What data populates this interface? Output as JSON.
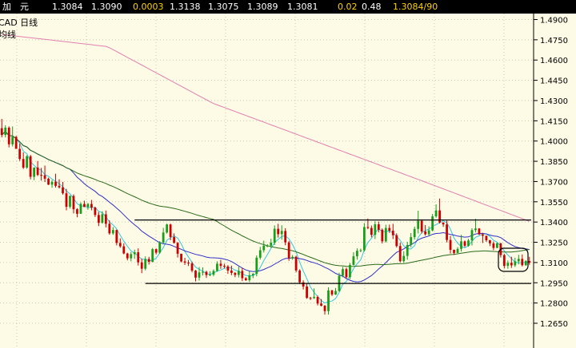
{
  "quote_bar": {
    "name": "加　元",
    "open": "1.3084",
    "high": "1.3090",
    "change": "0.0003",
    "last": "1.3138",
    "low": "1.3075",
    "bid": "1.3089",
    "ask": "1.3081",
    "pct": "0.02",
    "volume": "0.48",
    "bidask": "1.3084/90",
    "colors": {
      "label": "#ffffff",
      "highlight": "#ffd200"
    }
  },
  "chart_header": {
    "symbol_line": "CAD  日线",
    "ma_line": "均线"
  },
  "colors": {
    "background": "#fdfbe6",
    "grid": "#c8c8b4",
    "up_candle": "#1a9e1a",
    "down_candle": "#cc0000",
    "ma_fast": "#30c8e0",
    "ma_mid": "#3030c8",
    "ma_slow": "#2a6a1a",
    "ma_long": "#e080b0",
    "channel": "#000000"
  },
  "chart_data": {
    "type": "candlestick",
    "y_ticks": [
      "1.4900",
      "1.4750",
      "1.4600",
      "1.4450",
      "1.4300",
      "1.4150",
      "1.4000",
      "1.3850",
      "1.3700",
      "1.3550",
      "1.3400",
      "1.3250",
      "1.3100",
      "1.2950",
      "1.2800",
      "1.2650"
    ],
    "ylim": [
      1.257,
      1.496
    ],
    "grid": true,
    "candle_count": 149,
    "open": [
      1.4095,
      1.4045,
      1.4099,
      1.3976,
      1.4031,
      1.3942,
      1.3867,
      1.3803,
      1.3887,
      1.3735,
      1.3804,
      1.3749,
      1.3746,
      1.3721,
      1.3677,
      1.3698,
      1.3668,
      1.3657,
      1.3613,
      1.3513,
      1.3593,
      1.3495,
      1.3461,
      1.3534,
      1.3511,
      1.3534,
      1.3507,
      1.3452,
      1.3394,
      1.3457,
      1.3387,
      1.3316,
      1.3341,
      1.3245,
      1.322,
      1.3167,
      1.3131,
      1.3162,
      1.3176,
      1.3101,
      1.3054,
      1.3126,
      1.3105,
      1.3199,
      1.3173,
      1.3248,
      1.3322,
      1.3382,
      1.3289,
      1.3246,
      1.3165,
      1.3108,
      1.3099,
      1.3093,
      1.304,
      1.2988,
      1.3027,
      1.3031,
      1.3007,
      1.301,
      1.3038,
      1.3091,
      1.3075,
      1.3071,
      1.304,
      1.3023,
      1.3008,
      1.3038,
      1.2984,
      1.2969,
      1.3005,
      1.3016,
      1.3136,
      1.3191,
      1.3225,
      1.3225,
      1.3247,
      1.335,
      1.331,
      1.3334,
      1.3249,
      1.3131,
      1.3142,
      1.3041,
      1.2953,
      1.2922,
      1.2838,
      1.2837,
      1.2845,
      1.2796,
      1.278,
      1.274,
      1.2894,
      1.2863,
      1.2889,
      1.3002,
      1.3051,
      1.2991,
      1.3082,
      1.3146,
      1.3187,
      1.3191,
      1.3363,
      1.3356,
      1.3305,
      1.3383,
      1.3343,
      1.3257,
      1.3356,
      1.3336,
      1.3302,
      1.3222,
      1.311,
      1.3149,
      1.323,
      1.3288,
      1.3349,
      1.3409,
      1.333,
      1.3309,
      1.3338,
      1.3442,
      1.3486,
      1.3397,
      1.3382,
      1.3267,
      1.3194,
      1.3171,
      1.3201,
      1.3257,
      1.3224,
      1.3263,
      1.334,
      1.3352,
      1.3308,
      1.3298,
      1.3265,
      1.3242,
      1.3208,
      1.3242,
      1.3155,
      1.3075,
      1.3098,
      1.3079,
      1.3109,
      1.3127,
      1.308,
      1.3111
    ],
    "high": [
      1.4164,
      1.4117,
      1.4109,
      1.4108,
      1.4038,
      1.3981,
      1.3916,
      1.3895,
      1.3897,
      1.3804,
      1.3852,
      1.3801,
      1.3818,
      1.3729,
      1.3712,
      1.3758,
      1.3717,
      1.3697,
      1.3646,
      1.3597,
      1.3605,
      1.3503,
      1.3546,
      1.3558,
      1.3541,
      1.3564,
      1.3514,
      1.3475,
      1.348,
      1.3485,
      1.3413,
      1.3363,
      1.3344,
      1.3279,
      1.3243,
      1.3172,
      1.3177,
      1.3195,
      1.3205,
      1.3129,
      1.3145,
      1.3142,
      1.3208,
      1.3204,
      1.3258,
      1.3357,
      1.3388,
      1.3388,
      1.3316,
      1.3252,
      1.3165,
      1.3135,
      1.3119,
      1.3107,
      1.3045,
      1.3066,
      1.3064,
      1.3039,
      1.3035,
      1.3049,
      1.3109,
      1.312,
      1.3091,
      1.3081,
      1.3077,
      1.3029,
      1.3069,
      1.306,
      1.2991,
      1.3035,
      1.3022,
      1.3153,
      1.3216,
      1.3262,
      1.3236,
      1.3276,
      1.3375,
      1.3387,
      1.3376,
      1.3354,
      1.326,
      1.3156,
      1.3151,
      1.305,
      1.2968,
      1.2946,
      1.2846,
      1.2908,
      1.2855,
      1.2829,
      1.2785,
      1.2916,
      1.2897,
      1.2911,
      1.3024,
      1.3068,
      1.3063,
      1.3096,
      1.3176,
      1.3205,
      1.3203,
      1.3393,
      1.3426,
      1.3374,
      1.3406,
      1.3403,
      1.3352,
      1.338,
      1.3381,
      1.3387,
      1.3316,
      1.3247,
      1.3184,
      1.3253,
      1.3318,
      1.3366,
      1.3484,
      1.342,
      1.3378,
      1.3368,
      1.346,
      1.3531,
      1.3574,
      1.3397,
      1.341,
      1.3297,
      1.3196,
      1.3214,
      1.3305,
      1.3263,
      1.3275,
      1.3354,
      1.3424,
      1.3355,
      1.332,
      1.3299,
      1.3268,
      1.3256,
      1.3248,
      1.3246,
      1.3164,
      1.3115,
      1.3143,
      1.3135,
      1.3157,
      1.316,
      1.3117,
      1.3142
    ],
    "low": [
      1.4027,
      1.4027,
      1.3953,
      1.396,
      1.3942,
      1.3853,
      1.3793,
      1.3794,
      1.3716,
      1.371,
      1.374,
      1.3707,
      1.3696,
      1.3674,
      1.3654,
      1.3655,
      1.3648,
      1.3603,
      1.3487,
      1.35,
      1.3464,
      1.3435,
      1.3461,
      1.3511,
      1.3491,
      1.3487,
      1.3437,
      1.337,
      1.3388,
      1.336,
      1.3306,
      1.3305,
      1.3227,
      1.3209,
      1.3161,
      1.3116,
      1.3109,
      1.3127,
      1.3078,
      1.3021,
      1.3042,
      1.3085,
      1.3101,
      1.316,
      1.3164,
      1.3239,
      1.3314,
      1.3265,
      1.324,
      1.3137,
      1.3101,
      1.3082,
      1.3074,
      1.3027,
      1.296,
      1.2966,
      1.3004,
      1.2986,
      1.2999,
      1.2998,
      1.3031,
      1.3053,
      1.3057,
      1.3016,
      1.3006,
      1.2991,
      1.2989,
      1.2962,
      1.2964,
      1.2956,
      1.2984,
      1.2998,
      1.3122,
      1.3174,
      1.3213,
      1.3209,
      1.3229,
      1.3285,
      1.3269,
      1.3228,
      1.3113,
      1.312,
      1.3028,
      1.294,
      1.29,
      1.2831,
      1.2822,
      1.2829,
      1.2782,
      1.2775,
      1.2714,
      1.2714,
      1.2852,
      1.286,
      1.2884,
      1.2991,
      1.2979,
      1.2976,
      1.3078,
      1.3121,
      1.3176,
      1.318,
      1.3347,
      1.3287,
      1.3274,
      1.3323,
      1.3241,
      1.3247,
      1.3319,
      1.3274,
      1.3211,
      1.3101,
      1.3098,
      1.3121,
      1.3213,
      1.327,
      1.3315,
      1.3315,
      1.3299,
      1.3298,
      1.3331,
      1.3432,
      1.3389,
      1.3364,
      1.3249,
      1.3167,
      1.3156,
      1.317,
      1.3181,
      1.3214,
      1.3217,
      1.3227,
      1.3323,
      1.3304,
      1.3245,
      1.3253,
      1.3222,
      1.3191,
      1.3206,
      1.3137,
      1.3056,
      1.3054,
      1.306,
      1.3067,
      1.3086,
      1.3071,
      1.3076,
      1.3083
    ],
    "close": [
      1.4045,
      1.4099,
      1.3976,
      1.4031,
      1.3942,
      1.3867,
      1.3803,
      1.3887,
      1.3735,
      1.3804,
      1.3749,
      1.3746,
      1.3721,
      1.3677,
      1.3698,
      1.3668,
      1.3657,
      1.3613,
      1.3513,
      1.3593,
      1.3495,
      1.3461,
      1.3534,
      1.3511,
      1.3534,
      1.3507,
      1.3452,
      1.3394,
      1.3457,
      1.3387,
      1.3316,
      1.3341,
      1.3245,
      1.322,
      1.3167,
      1.3131,
      1.3162,
      1.3176,
      1.3101,
      1.3054,
      1.3126,
      1.3105,
      1.3199,
      1.3173,
      1.3248,
      1.3322,
      1.3382,
      1.3289,
      1.3246,
      1.3165,
      1.3108,
      1.3099,
      1.3093,
      1.304,
      1.2988,
      1.3027,
      1.3031,
      1.3007,
      1.301,
      1.3038,
      1.3091,
      1.3075,
      1.3071,
      1.304,
      1.3023,
      1.3008,
      1.3038,
      1.2984,
      1.2969,
      1.3005,
      1.3016,
      1.3136,
      1.3191,
      1.3225,
      1.3225,
      1.3247,
      1.335,
      1.331,
      1.3334,
      1.3249,
      1.3131,
      1.3142,
      1.3041,
      1.2953,
      1.2922,
      1.2838,
      1.2837,
      1.2845,
      1.2796,
      1.278,
      1.274,
      1.2894,
      1.2863,
      1.2889,
      1.3002,
      1.3051,
      1.2991,
      1.3082,
      1.3146,
      1.3187,
      1.3191,
      1.3363,
      1.3356,
      1.3305,
      1.3383,
      1.3343,
      1.3257,
      1.3356,
      1.3336,
      1.3302,
      1.3222,
      1.311,
      1.3149,
      1.323,
      1.3288,
      1.3349,
      1.3409,
      1.333,
      1.3309,
      1.3338,
      1.3442,
      1.3486,
      1.3397,
      1.3382,
      1.3267,
      1.3194,
      1.3171,
      1.3201,
      1.3257,
      1.3224,
      1.3263,
      1.334,
      1.3352,
      1.3308,
      1.3298,
      1.3265,
      1.3242,
      1.3208,
      1.3242,
      1.3155,
      1.3075,
      1.3098,
      1.3079,
      1.3109,
      1.3127,
      1.308,
      1.3111,
      1.3098
    ],
    "channel": {
      "upper": 1.3415,
      "lower": 1.2945,
      "upper_from_index": 37,
      "lower_from_index": 40
    },
    "moving_averages": [
      {
        "periods": 5,
        "color_key": "ma_fast"
      },
      {
        "periods": 20,
        "color_key": "ma_mid"
      },
      {
        "periods": 60,
        "color_key": "ma_slow"
      },
      {
        "periods": 200,
        "color_key": "ma_long"
      }
    ]
  }
}
